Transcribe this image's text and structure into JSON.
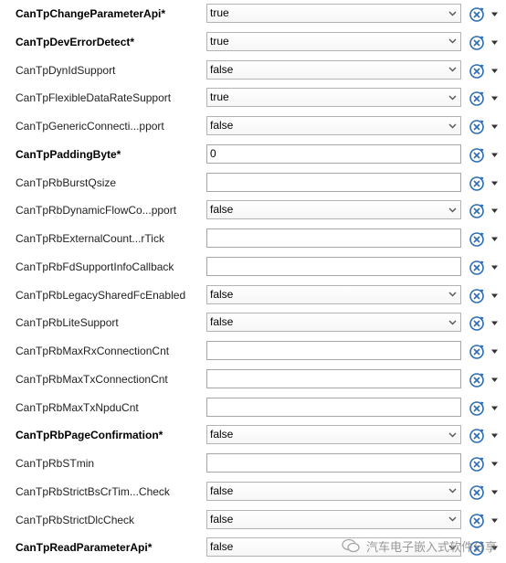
{
  "parameters": [
    {
      "label": "CanTpChangeParameterApi*",
      "bold": true,
      "type": "combo",
      "value": "true"
    },
    {
      "label": "CanTpDevErrorDetect*",
      "bold": true,
      "type": "combo",
      "value": "true"
    },
    {
      "label": "CanTpDynIdSupport",
      "bold": false,
      "type": "combo",
      "value": "false"
    },
    {
      "label": "CanTpFlexibleDataRateSupport",
      "bold": false,
      "type": "combo",
      "value": "true"
    },
    {
      "label": "CanTpGenericConnecti...pport",
      "bold": false,
      "type": "combo",
      "value": "false"
    },
    {
      "label": "CanTpPaddingByte*",
      "bold": true,
      "type": "text",
      "value": "0"
    },
    {
      "label": "CanTpRbBurstQsize",
      "bold": false,
      "type": "text",
      "value": ""
    },
    {
      "label": "CanTpRbDynamicFlowCo...pport",
      "bold": false,
      "type": "combo",
      "value": "false"
    },
    {
      "label": "CanTpRbExternalCount...rTick",
      "bold": false,
      "type": "text",
      "value": ""
    },
    {
      "label": "CanTpRbFdSupportInfoCallback",
      "bold": false,
      "type": "text",
      "value": ""
    },
    {
      "label": "CanTpRbLegacySharedFcEnabled",
      "bold": false,
      "type": "combo",
      "value": "false"
    },
    {
      "label": "CanTpRbLiteSupport",
      "bold": false,
      "type": "combo",
      "value": "false"
    },
    {
      "label": "CanTpRbMaxRxConnectionCnt",
      "bold": false,
      "type": "text",
      "value": ""
    },
    {
      "label": "CanTpRbMaxTxConnectionCnt",
      "bold": false,
      "type": "text",
      "value": ""
    },
    {
      "label": "CanTpRbMaxTxNpduCnt",
      "bold": false,
      "type": "text",
      "value": ""
    },
    {
      "label": "CanTpRbPageConfirmation*",
      "bold": true,
      "type": "combo",
      "value": "false"
    },
    {
      "label": "CanTpRbSTmin",
      "bold": false,
      "type": "text",
      "value": ""
    },
    {
      "label": "CanTpRbStrictBsCrTim...Check",
      "bold": false,
      "type": "combo",
      "value": "false"
    },
    {
      "label": "CanTpRbStrictDlcCheck",
      "bold": false,
      "type": "combo",
      "value": "false"
    },
    {
      "label": "CanTpReadParameterApi*",
      "bold": true,
      "type": "combo",
      "value": "false"
    }
  ],
  "icons": {
    "dropdown": "chevron-down-icon",
    "reset": "reset-default-icon",
    "menu": "triangle-down-icon"
  },
  "colors": {
    "reset_icon": "#2d6db5",
    "border": "#a6a6a6"
  },
  "watermark": {
    "text": "汽车电子嵌入式软件分享"
  }
}
